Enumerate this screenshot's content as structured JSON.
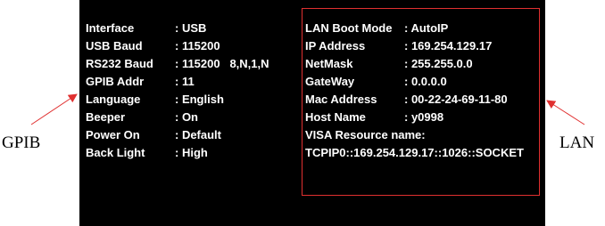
{
  "system_info": [
    {
      "label": "Interface",
      "value": ": USB"
    },
    {
      "label": "USB Baud",
      "value": ": 115200"
    },
    {
      "label": "RS232 Baud",
      "value": ": 115200   8,N,1,N"
    },
    {
      "label": "GPIB Addr",
      "value": ": 11"
    },
    {
      "label": "Language",
      "value": ": English"
    },
    {
      "label": "Beeper",
      "value": ": On"
    },
    {
      "label": "Power On",
      "value": ": Default"
    },
    {
      "label": "Back Light",
      "value": ": High"
    }
  ],
  "lan_info": [
    {
      "label": "LAN Boot Mode",
      "value": ": AutoIP"
    },
    {
      "label": "IP Address",
      "value": ": 169.254.129.17"
    },
    {
      "label": "NetMask",
      "value": ": 255.255.0.0"
    },
    {
      "label": "GateWay",
      "value": ": 0.0.0.0"
    },
    {
      "label": "Mac Address",
      "value": ": 00-22-24-69-11-80"
    },
    {
      "label": "Host Name",
      "value": ": y0998"
    }
  ],
  "visa": {
    "label": "VISA Resource name:",
    "value": "TCPIP0::169.254.129.17::1026::SOCKET"
  },
  "callouts": {
    "gpib": "GPIB",
    "lan": "LAN"
  },
  "colors": {
    "screen_bg": "#000000",
    "text": "#ffffff",
    "highlight_border": "#e03030",
    "arrow": "#e03030"
  }
}
